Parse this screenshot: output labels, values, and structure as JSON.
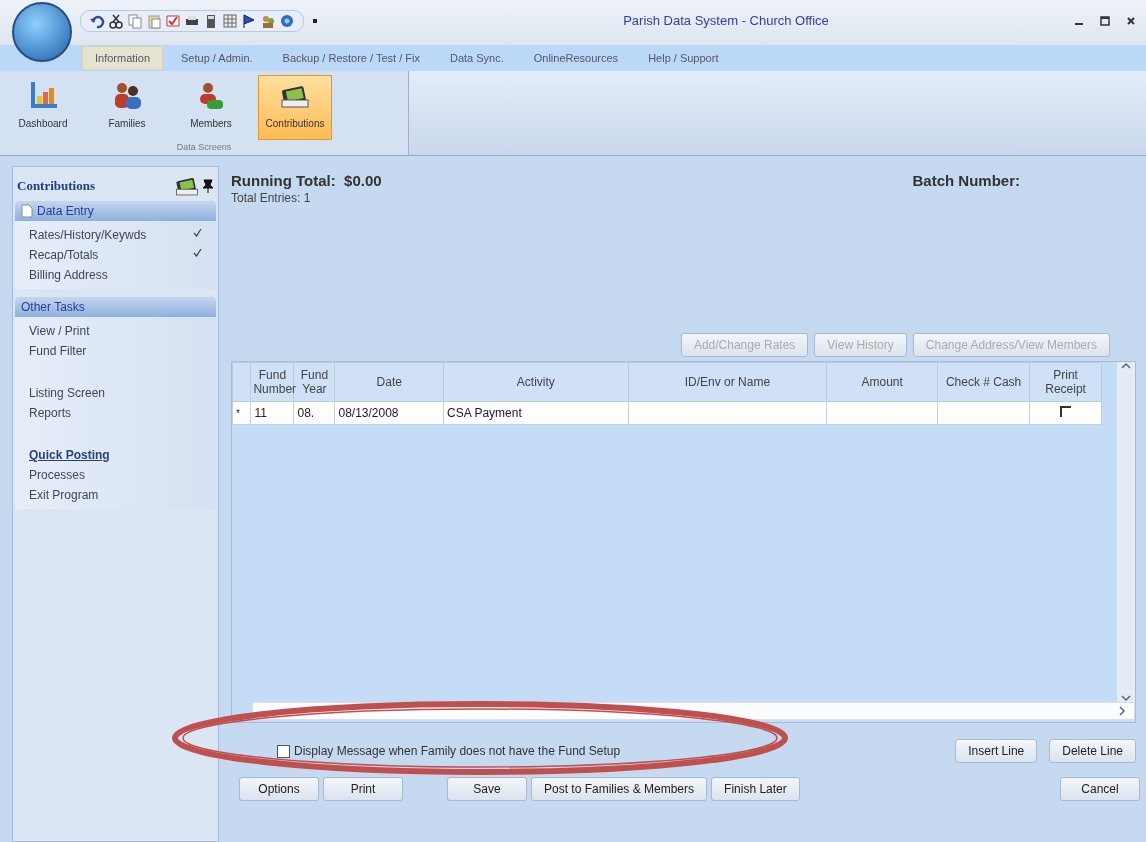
{
  "window": {
    "title": "Parish Data System - Church Office"
  },
  "menu_tabs": [
    {
      "label": "Information",
      "selected": true
    },
    {
      "label": "Setup / Admin.",
      "selected": false
    },
    {
      "label": "Backup / Restore / Test / Fix",
      "selected": false
    },
    {
      "label": "Data Sync.",
      "selected": false
    },
    {
      "label": "OnlineResources",
      "selected": false
    },
    {
      "label": "Help / Support",
      "selected": false
    }
  ],
  "ribbon": {
    "group_label": "Data Screens",
    "buttons": [
      {
        "label": "Dashboard",
        "kind": "chart",
        "selected": false
      },
      {
        "label": "Families",
        "kind": "family",
        "selected": false
      },
      {
        "label": "Members",
        "kind": "member",
        "selected": false
      },
      {
        "label": "Contributions",
        "kind": "wallet",
        "selected": true
      }
    ]
  },
  "sidebar": {
    "title": "Contributions",
    "sections": [
      {
        "header": "Data Entry",
        "items": [
          {
            "label": "Rates/History/Keywds",
            "checked": true
          },
          {
            "label": "Recap/Totals",
            "checked": true
          },
          {
            "label": "Billing Address",
            "checked": false
          }
        ]
      },
      {
        "header": "Other Tasks",
        "groups": [
          [
            {
              "label": "View / Print",
              "emphasis": false
            },
            {
              "label": "Fund Filter",
              "emphasis": false
            }
          ],
          [
            {
              "label": "Listing Screen",
              "emphasis": false
            },
            {
              "label": "Reports",
              "emphasis": false
            }
          ],
          [
            {
              "label": "Quick Posting",
              "emphasis": true
            },
            {
              "label": "Processes",
              "emphasis": false
            },
            {
              "label": "Exit Program",
              "emphasis": false
            }
          ]
        ]
      }
    ]
  },
  "summary": {
    "running_total_label": "Running Total:",
    "running_total": "$0.00",
    "total_entries": "Total Entries:  1",
    "batch_label": "Batch Number:"
  },
  "grid_buttons": [
    {
      "label": "Add/Change Rates",
      "disabled": true
    },
    {
      "label": "View History",
      "disabled": true
    },
    {
      "label": "Change Address/View Members",
      "disabled": true
    }
  ],
  "table": {
    "columns": [
      "Fund Number",
      "Fund Year",
      "Date",
      "Activity",
      "ID/Env or Name",
      "Amount",
      "Check # Cash",
      "Print Receipt"
    ],
    "rows": [
      {
        "marker": "*",
        "cells": [
          "11",
          "08.",
          "08/13/2008",
          "CSA Payment",
          "",
          "",
          ""
        ],
        "print_receipt": false
      }
    ]
  },
  "display_message": {
    "label": "Display Message when Family does not have the Fund Setup",
    "checked": false
  },
  "line_buttons": [
    "Insert Line",
    "Delete Line"
  ],
  "footer_buttons": [
    "Options",
    "Print",
    "Save",
    "Post to Families & Members",
    "Finish Later",
    "Cancel"
  ]
}
